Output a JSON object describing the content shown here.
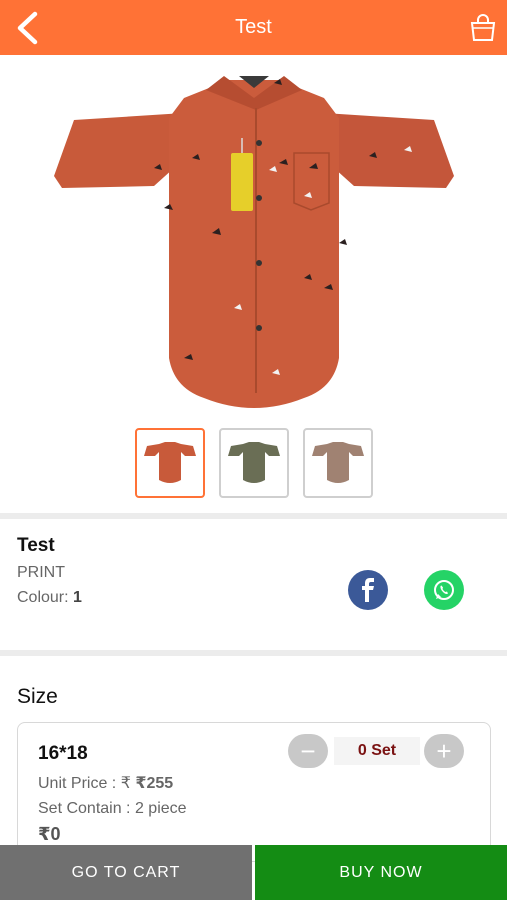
{
  "header": {
    "title": "Test",
    "bar_color": "#ff7236",
    "back_icon": "chevron-left-icon",
    "bag_icon": "shopping-bag-icon"
  },
  "gallery": {
    "thumbnails": [
      {
        "color": "#c85a3a",
        "active": true
      },
      {
        "color": "#6a6e55",
        "active": false
      },
      {
        "color": "#a08272",
        "active": false
      }
    ]
  },
  "product": {
    "name": "Test",
    "type": "PRINT",
    "colour_label": "Colour:",
    "colour_value": "1"
  },
  "size_section": {
    "heading": "Size",
    "items": [
      {
        "size": "16*18",
        "unit_price_label": "Unit Price : ₹",
        "unit_price_value": "₹255",
        "set_contain": "Set Contain : 2 piece",
        "total": "₹0",
        "qty_text": "0 Set",
        "minus": "−",
        "plus": "+"
      }
    ]
  },
  "actions": {
    "go_to_cart": "GO TO CART",
    "buy_now": "BUY NOW"
  }
}
